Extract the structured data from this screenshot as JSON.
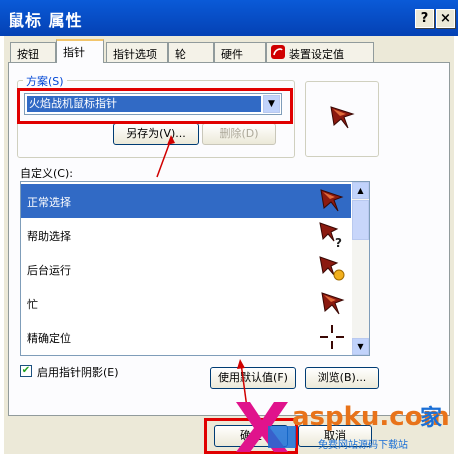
{
  "window": {
    "title": "鼠标 属性",
    "help_button": "?",
    "close_button": "×"
  },
  "tabs": [
    {
      "label": "按钮"
    },
    {
      "label": "指针"
    },
    {
      "label": "指针选项"
    },
    {
      "label": "轮"
    },
    {
      "label": "硬件"
    },
    {
      "label": "装置设定值"
    }
  ],
  "scheme": {
    "group_label": "方案(S)",
    "selected": "火焰战机鼠标指针",
    "save_as_button": "另存为(V)...",
    "delete_button": "删除(D)"
  },
  "customize": {
    "label": "自定义(C):",
    "items": [
      {
        "label": "正常选择",
        "icon": "arrow-pointer-icon",
        "selected": true
      },
      {
        "label": "帮助选择",
        "icon": "help-pointer-icon",
        "selected": false
      },
      {
        "label": "后台运行",
        "icon": "working-pointer-icon",
        "selected": false
      },
      {
        "label": "忙",
        "icon": "busy-pointer-icon",
        "selected": false
      },
      {
        "label": "精确定位",
        "icon": "crosshair-icon",
        "selected": false
      }
    ]
  },
  "shadow_checkbox": {
    "label": "启用指针阴影(E)",
    "checked": true
  },
  "use_default_button": "使用默认值(F)",
  "browse_button": "浏览(B)...",
  "footer": {
    "ok_button": "确定",
    "cancel_button": "取消"
  },
  "watermark": {
    "text": "aspku.com",
    "subtext": "免费网站源码下载站",
    "cn": "家"
  },
  "colors": {
    "accent": "#e00000",
    "selection": "#316ac5",
    "title": "#0441b4"
  }
}
